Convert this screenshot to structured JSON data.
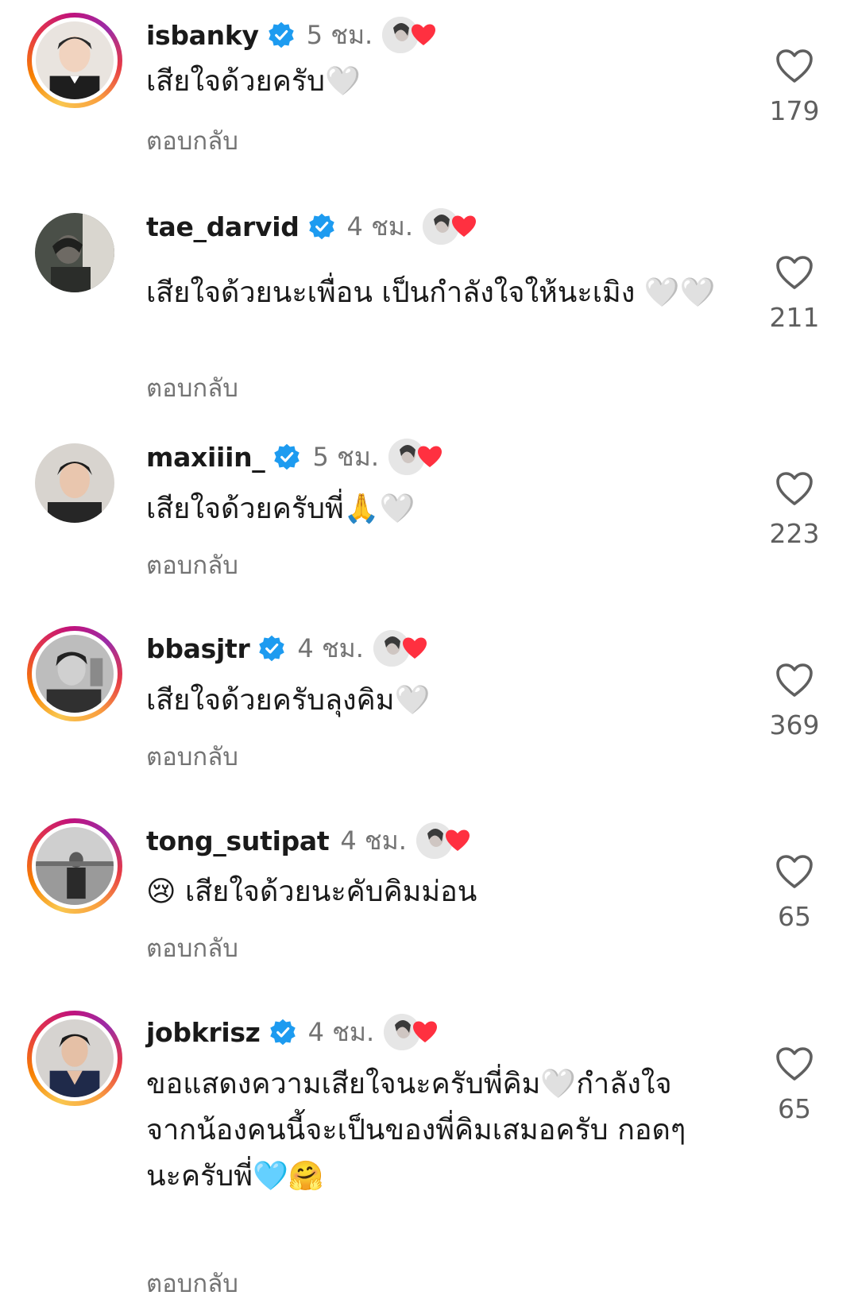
{
  "comments": [
    {
      "username": "isbanky",
      "verified": true,
      "time": "5 ชม.",
      "text": "เสียใจด้วยครับ🤍",
      "reply": "ตอบกลับ",
      "likes": "179",
      "story_ring": true
    },
    {
      "username": "tae_darvid",
      "verified": true,
      "time": "4 ชม.",
      "text": "เสียใจด้วยนะเพื่อน เป็นกำลังใจให้นะเมิง 🤍🤍",
      "reply": "ตอบกลับ",
      "likes": "211",
      "story_ring": false
    },
    {
      "username": "maxiiin_",
      "verified": true,
      "time": "5 ชม.",
      "text": "เสียใจด้วยครับพี่🙏🤍",
      "reply": "ตอบกลับ",
      "likes": "223",
      "story_ring": false
    },
    {
      "username": "bbasjtr",
      "verified": true,
      "time": "4 ชม.",
      "text": "เสียใจด้วยครับลุงคิม🤍",
      "reply": "ตอบกลับ",
      "likes": "369",
      "story_ring": true
    },
    {
      "username": "tong_sutipat",
      "verified": false,
      "time": "4 ชม.",
      "text": "😢 เสียใจด้วยนะคับคิมม่อน",
      "reply": "ตอบกลับ",
      "likes": "65",
      "story_ring": true
    },
    {
      "username": "jobkrisz",
      "verified": true,
      "time": "4 ชม.",
      "text": "ขอแสดงความเสียใจนะครับพี่คิม🤍กำลังใจจากน้องคนนี้จะเป็นของพี่คิมเสมอครับ กอดๆนะครับพี่🩵🤗",
      "reply": "ตอบกลับ",
      "likes": "65",
      "story_ring": true
    }
  ],
  "icons": {
    "verified": "verified-badge-icon",
    "like": "heart-outline-icon",
    "liked_by_creator": "creator-liked-heart-icon"
  },
  "colors": {
    "verified": "#1d9bf0",
    "heart_red": "#ff3040",
    "muted_text": "#737373"
  }
}
